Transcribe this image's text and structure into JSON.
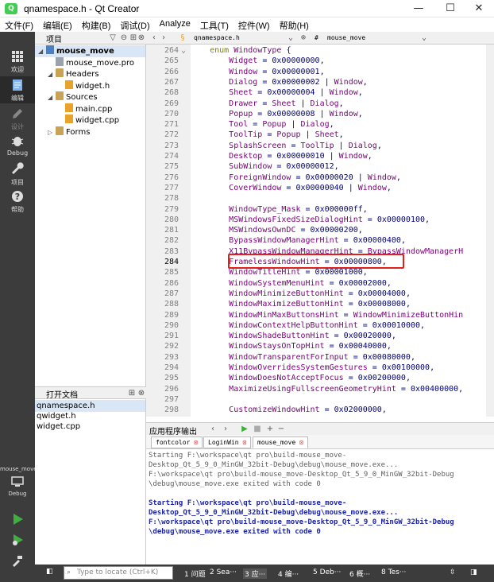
{
  "window": {
    "title": "qnamespace.h - Qt Creator",
    "controls": [
      "—",
      "☐",
      "✕"
    ]
  },
  "menu": [
    "文件(F)",
    "编辑(E)",
    "构建(B)",
    "调试(D)",
    "Analyze",
    "工具(T)",
    "控件(W)",
    "帮助(H)"
  ],
  "modes": [
    {
      "label": "欢迎",
      "icon": "grid-icon"
    },
    {
      "label": "编辑",
      "icon": "edit-doc-icon",
      "active": true
    },
    {
      "label": "设计",
      "icon": "pencil-icon"
    },
    {
      "label": "Debug",
      "icon": "bug-icon"
    },
    {
      "label": "项目",
      "icon": "wrench-icon"
    },
    {
      "label": "帮助",
      "icon": "help-icon"
    }
  ],
  "target": {
    "project": "mouse_move",
    "config": "Debug"
  },
  "project_panel": {
    "title": "项目",
    "tree": [
      {
        "label": "mouse_move",
        "indent": 0,
        "expanded": true,
        "bold": true,
        "selected": true,
        "type": "project"
      },
      {
        "label": "mouse_move.pro",
        "indent": 1,
        "type": "pro"
      },
      {
        "label": "Headers",
        "indent": 1,
        "expanded": true,
        "type": "folder"
      },
      {
        "label": "widget.h",
        "indent": 2,
        "type": "h"
      },
      {
        "label": "Sources",
        "indent": 1,
        "expanded": true,
        "type": "folder"
      },
      {
        "label": "main.cpp",
        "indent": 2,
        "type": "cpp"
      },
      {
        "label": "widget.cpp",
        "indent": 2,
        "type": "cpp"
      },
      {
        "label": "Forms",
        "indent": 1,
        "expanded": false,
        "type": "folder"
      }
    ]
  },
  "open_docs": {
    "title": "打开文档",
    "items": [
      "qnamespace.h",
      "qwidget.h",
      "widget.cpp"
    ]
  },
  "editor": {
    "file_tab": "qnamespace.h",
    "symbol_tab": "mouse_move",
    "current_line": "284",
    "lines": [
      {
        "n": "264",
        "t": "    enum WindowType {",
        "fold": "⌄"
      },
      {
        "n": "265",
        "t": "        Widget = 0x00000000,"
      },
      {
        "n": "266",
        "t": "        Window = 0x00000001,"
      },
      {
        "n": "267",
        "t": "        Dialog = 0x00000002 | Window,"
      },
      {
        "n": "268",
        "t": "        Sheet = 0x00000004 | Window,"
      },
      {
        "n": "269",
        "t": "        Drawer = Sheet | Dialog,"
      },
      {
        "n": "270",
        "t": "        Popup = 0x00000008 | Window,"
      },
      {
        "n": "271",
        "t": "        Tool = Popup | Dialog,"
      },
      {
        "n": "272",
        "t": "        ToolTip = Popup | Sheet,"
      },
      {
        "n": "273",
        "t": "        SplashScreen = ToolTip | Dialog,"
      },
      {
        "n": "274",
        "t": "        Desktop = 0x00000010 | Window,"
      },
      {
        "n": "275",
        "t": "        SubWindow = 0x00000012,"
      },
      {
        "n": "276",
        "t": "        ForeignWindow = 0x00000020 | Window,"
      },
      {
        "n": "277",
        "t": "        CoverWindow = 0x00000040 | Window,"
      },
      {
        "n": "278",
        "t": ""
      },
      {
        "n": "279",
        "t": "        WindowType_Mask = 0x000000ff,"
      },
      {
        "n": "280",
        "t": "        MSWindowsFixedSizeDialogHint = 0x00000100,"
      },
      {
        "n": "281",
        "t": "        MSWindowsOwnDC = 0x00000200,"
      },
      {
        "n": "282",
        "t": "        BypassWindowManagerHint = 0x00000400,"
      },
      {
        "n": "283",
        "t": "        X11BypassWindowManagerHint = BypassWindowManagerH"
      },
      {
        "n": "284",
        "t": "        FramelessWindowHint = 0x00000800,"
      },
      {
        "n": "285",
        "t": "        WindowTitleHint = 0x00001000,"
      },
      {
        "n": "286",
        "t": "        WindowSystemMenuHint = 0x00002000,"
      },
      {
        "n": "287",
        "t": "        WindowMinimizeButtonHint = 0x00004000,"
      },
      {
        "n": "288",
        "t": "        WindowMaximizeButtonHint = 0x00008000,"
      },
      {
        "n": "289",
        "t": "        WindowMinMaxButtonsHint = WindowMinimizeButtonHin"
      },
      {
        "n": "290",
        "t": "        WindowContextHelpButtonHint = 0x00010000,"
      },
      {
        "n": "291",
        "t": "        WindowShadeButtonHint = 0x00020000,"
      },
      {
        "n": "292",
        "t": "        WindowStaysOnTopHint = 0x00040000,"
      },
      {
        "n": "293",
        "t": "        WindowTransparentForInput = 0x00080000,"
      },
      {
        "n": "294",
        "t": "        WindowOverridesSystemGestures = 0x00100000,"
      },
      {
        "n": "295",
        "t": "        WindowDoesNotAcceptFocus = 0x00200000,"
      },
      {
        "n": "296",
        "t": "        MaximizeUsingFullscreenGeometryHint = 0x00400000,"
      },
      {
        "n": "297",
        "t": ""
      },
      {
        "n": "298",
        "t": "        CustomizeWindowHint = 0x02000000,"
      }
    ],
    "highlight_color": "#e0201a"
  },
  "output": {
    "title": "应用程序输出",
    "tabs": [
      "fontcolor",
      "LoginWin",
      "mouse_move"
    ],
    "active_tab": "mouse_move",
    "lines": [
      {
        "t": "Starting F:\\workspace\\qt pro\\build-mouse_move-",
        "style": "gray"
      },
      {
        "t": "Desktop_Qt_5_9_0_MinGW_32bit-Debug\\debug\\mouse_move.exe...",
        "style": "gray"
      },
      {
        "t": "F:\\workspace\\qt pro\\build-mouse_move-Desktop_Qt_5_9_0_MinGW_32bit-Debug",
        "style": "gray"
      },
      {
        "t": "\\debug\\mouse_move.exe exited with code 0",
        "style": "gray"
      },
      {
        "t": "",
        "style": "gray"
      },
      {
        "t": "Starting F:\\workspace\\qt pro\\build-mouse_move-",
        "style": "blue"
      },
      {
        "t": "Desktop_Qt_5_9_0_MinGW_32bit-Debug\\debug\\mouse_move.exe...",
        "style": "blue"
      },
      {
        "t": "F:\\workspace\\qt pro\\build-mouse_move-Desktop_Qt_5_9_0_MinGW_32bit-Debug",
        "style": "blue"
      },
      {
        "t": "\\debug\\mouse_move.exe exited with code 0",
        "style": "blue"
      }
    ]
  },
  "statusbar": {
    "locator_placeholder": "Type to locate (Ctrl+K)",
    "panes": [
      "1 问题",
      "2 Sea···",
      "3 应···",
      "4 编···",
      "5 Deb···",
      "6 概···",
      "8 Tes···"
    ]
  },
  "colors": {
    "sidebar": "#3c3c3c",
    "keyword": "#808000",
    "number": "#000080",
    "enum_value": "#800080",
    "output_blue": "#1c24a5"
  }
}
